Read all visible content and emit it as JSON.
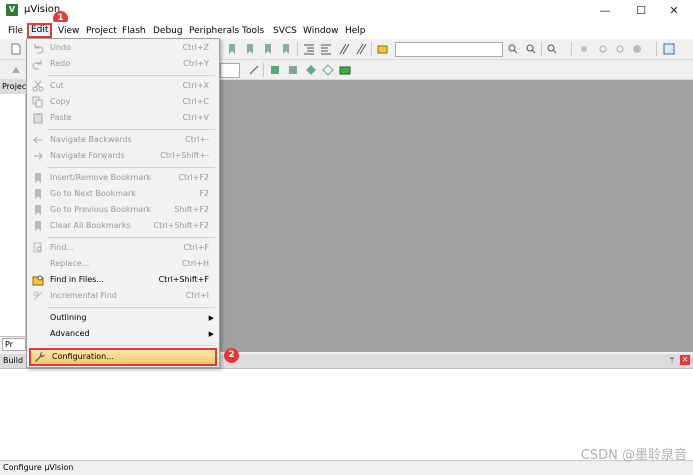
{
  "window": {
    "title": "µVision",
    "logo": "V",
    "minimize_icon": "—",
    "maximize_icon": "☐",
    "close_icon": "✕"
  },
  "menubar": {
    "items": [
      "File",
      "Edit",
      "View",
      "Project",
      "Flash",
      "Debug",
      "Peripherals",
      "Tools",
      "SVCS",
      "Window",
      "Help"
    ],
    "active": "Edit"
  },
  "annotations": {
    "step1": "1",
    "step2": "2"
  },
  "edit_menu": {
    "items": [
      {
        "label": "Undo",
        "shortcut": "Ctrl+Z",
        "icon": "undo-icon",
        "enabled": false
      },
      {
        "label": "Redo",
        "shortcut": "Ctrl+Y",
        "icon": "redo-icon",
        "enabled": false
      },
      {
        "label": "Cut",
        "shortcut": "Ctrl+X",
        "icon": "cut-icon",
        "enabled": false
      },
      {
        "label": "Copy",
        "shortcut": "Ctrl+C",
        "icon": "copy-icon",
        "enabled": false
      },
      {
        "label": "Paste",
        "shortcut": "Ctrl+V",
        "icon": "paste-icon",
        "enabled": false
      },
      {
        "label": "Navigate Backwards",
        "shortcut": "Ctrl+-",
        "icon": "arrow-left-icon",
        "enabled": false
      },
      {
        "label": "Navigate Forwards",
        "shortcut": "Ctrl+Shift+-",
        "icon": "arrow-right-icon",
        "enabled": false
      },
      {
        "label": "Insert/Remove Bookmark",
        "shortcut": "Ctrl+F2",
        "icon": "bookmark-icon",
        "enabled": false
      },
      {
        "label": "Go to Next Bookmark",
        "shortcut": "F2",
        "icon": "bookmark-next-icon",
        "enabled": false
      },
      {
        "label": "Go to Previous Bookmark",
        "shortcut": "Shift+F2",
        "icon": "bookmark-prev-icon",
        "enabled": false
      },
      {
        "label": "Clear All Bookmarks",
        "shortcut": "Ctrl+Shift+F2",
        "icon": "bookmark-clear-icon",
        "enabled": false
      },
      {
        "label": "Find...",
        "shortcut": "Ctrl+F",
        "icon": "find-icon",
        "enabled": false
      },
      {
        "label": "Replace...",
        "shortcut": "Ctrl+H",
        "icon": "",
        "enabled": false
      },
      {
        "label": "Find in Files...",
        "shortcut": "Ctrl+Shift+F",
        "icon": "find-in-files-icon",
        "enabled": true
      },
      {
        "label": "Incremental Find",
        "shortcut": "Ctrl+I",
        "icon": "incremental-find-icon",
        "enabled": false
      },
      {
        "label": "Outlining",
        "shortcut": "",
        "icon": "",
        "enabled": true,
        "submenu": true
      },
      {
        "label": "Advanced",
        "shortcut": "",
        "icon": "",
        "enabled": true,
        "submenu": true
      },
      {
        "label": "Configuration...",
        "shortcut": "",
        "icon": "wrench-icon",
        "enabled": true,
        "highlighted": true
      }
    ]
  },
  "panels": {
    "project_title": "Project",
    "project_tab": "Pr",
    "build_output_title": "Build Output",
    "pin_icon": "ᛘ",
    "close_icon": "✕"
  },
  "status_bar": {
    "text": "Configure µVision"
  },
  "watermark": "CSDN @墨聆泉音",
  "colors": {
    "highlight_border": "#e53935",
    "editor_bg": "#a0a0a0",
    "menu_highlight": "#f9c86a"
  }
}
